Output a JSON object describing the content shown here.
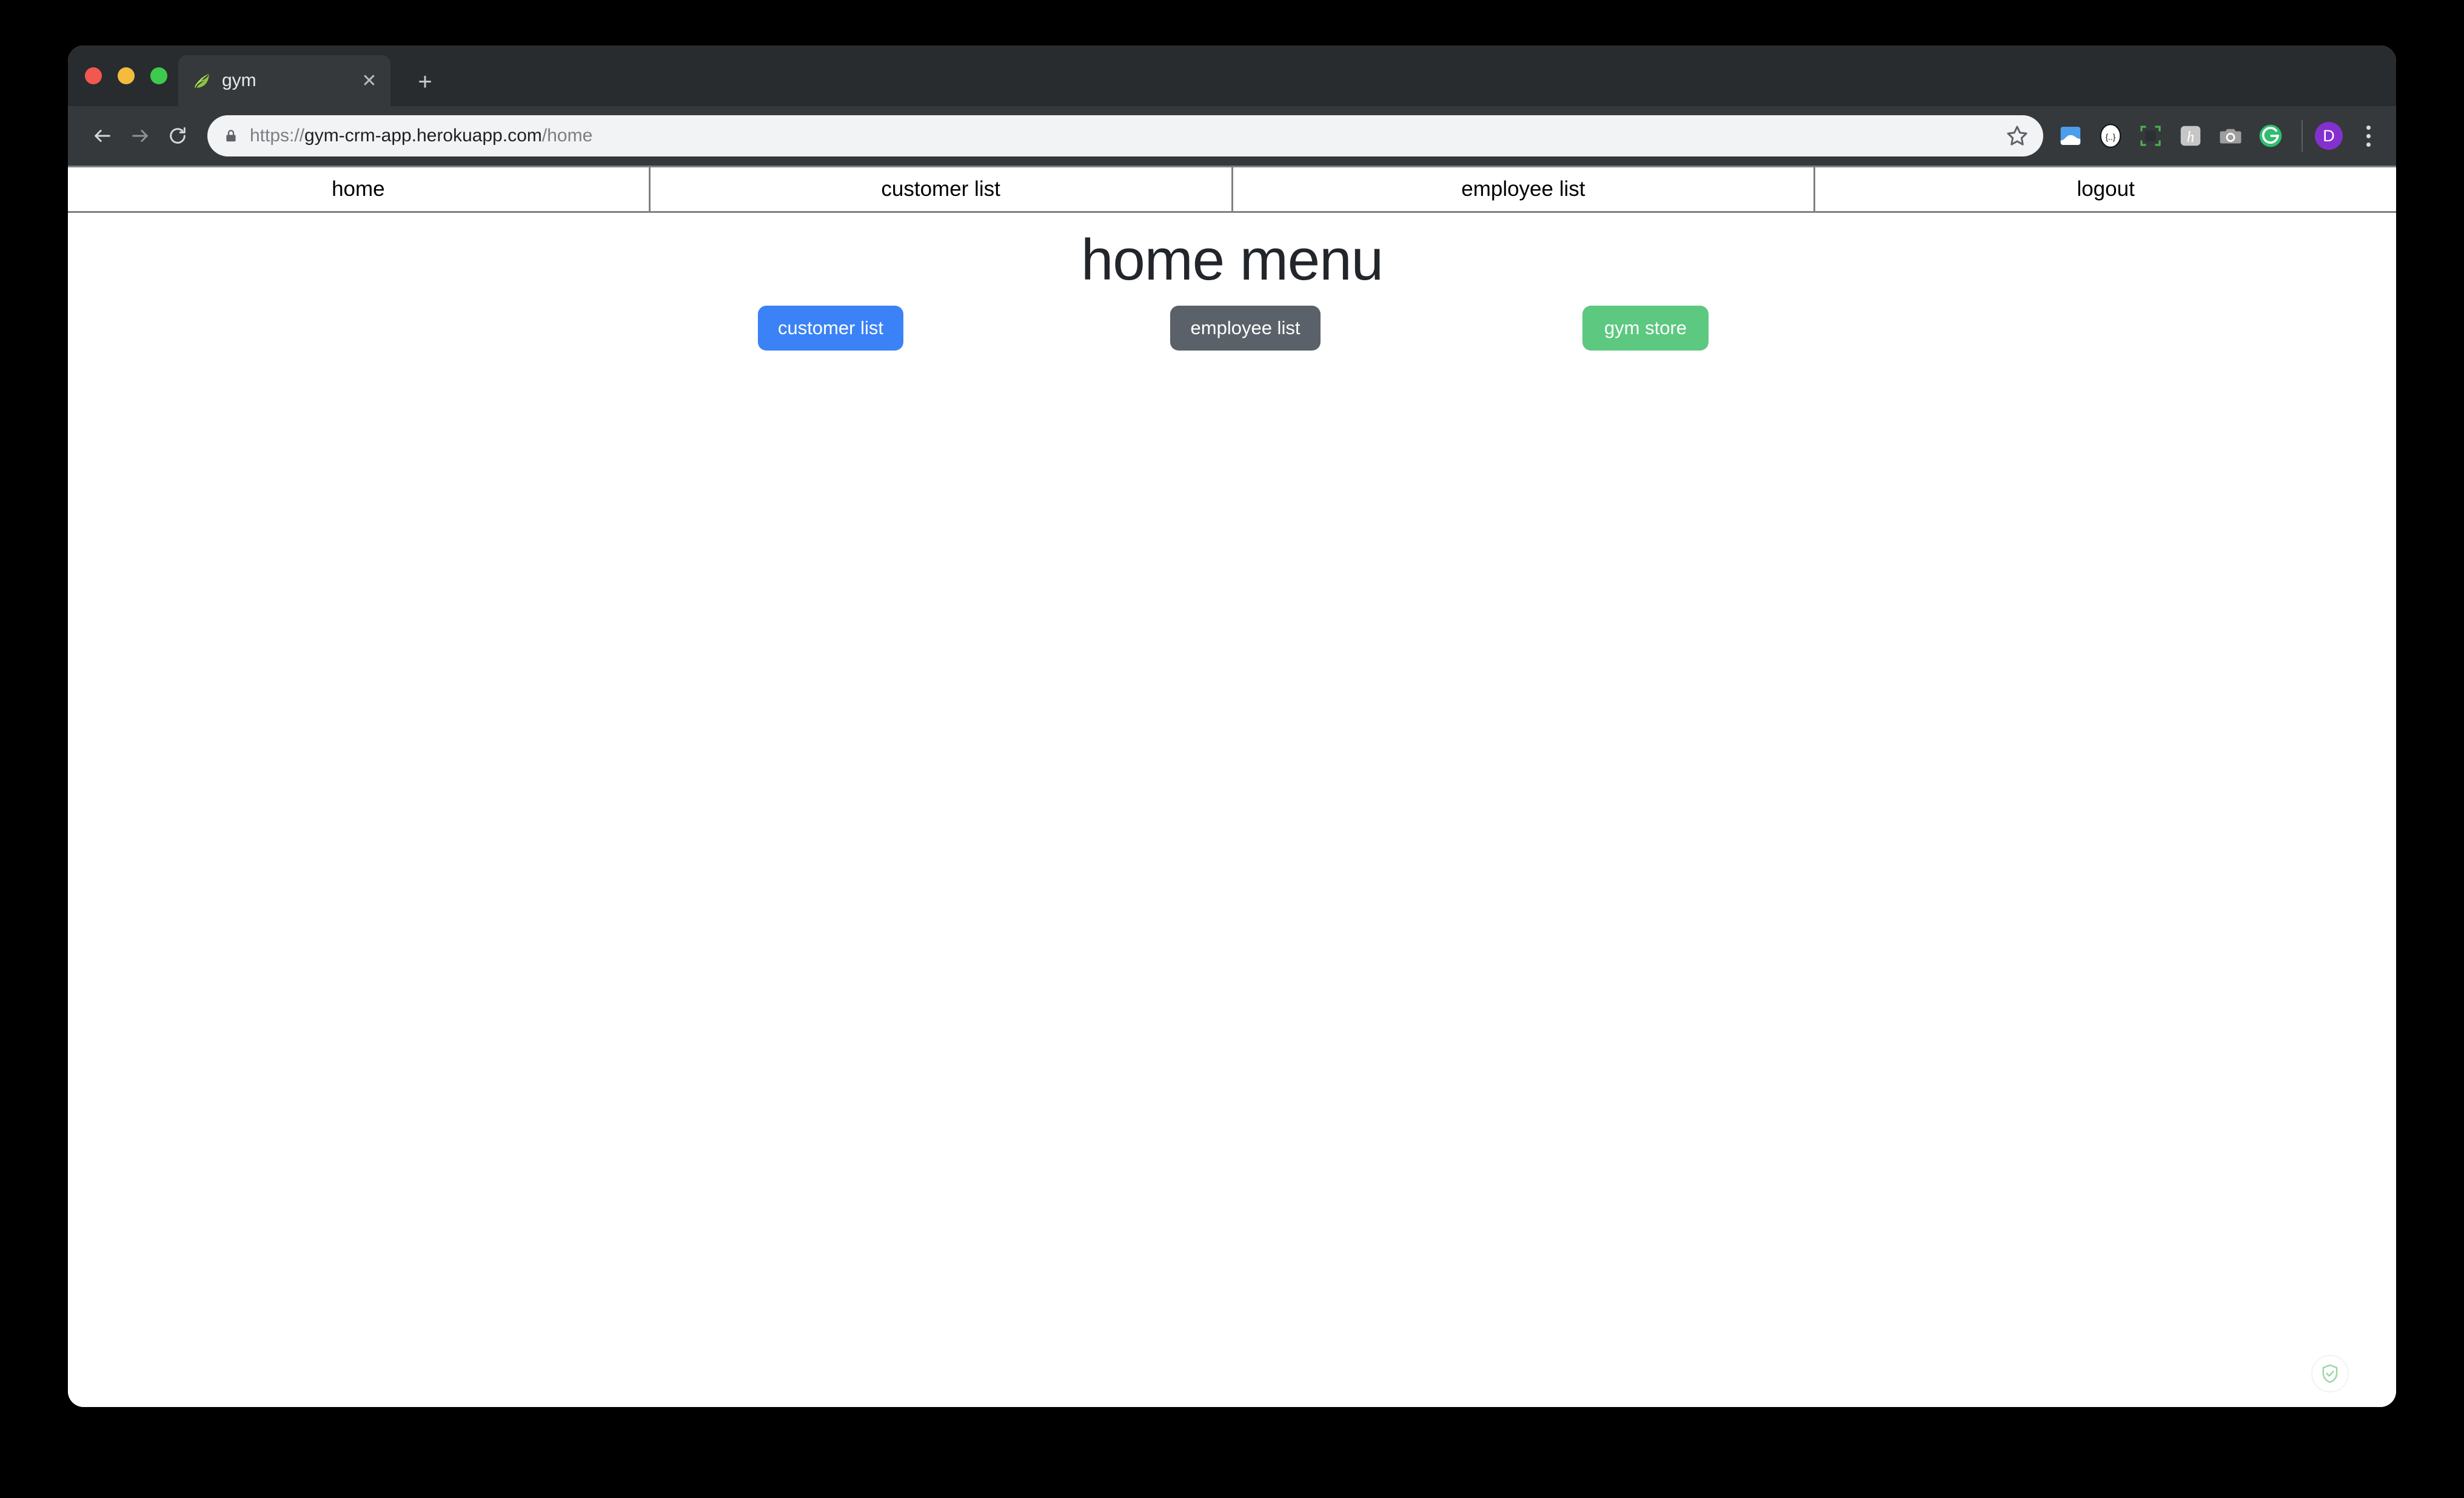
{
  "browser": {
    "traffic_lights": [
      {
        "name": "close",
        "color": "#f2584f"
      },
      {
        "name": "minimize",
        "color": "#f4bc3e"
      },
      {
        "name": "maximize",
        "color": "#3ecb4d"
      }
    ],
    "tab": {
      "title": "gym",
      "favicon": "spring-leaf-icon",
      "close_label": "✕"
    },
    "new_tab_label": "+",
    "nav": {
      "back": "back-arrow-icon",
      "forward": "forward-arrow-icon",
      "reload": "reload-icon"
    },
    "omnibox": {
      "lock": "lock-icon",
      "url_scheme": "https://",
      "url_host": "gym-crm-app.herokuapp.com",
      "url_path": "/home",
      "full_url": "https://gym-crm-app.herokuapp.com/home",
      "bookmark": "star-icon"
    },
    "extensions": [
      {
        "name": "blue-document-extension",
        "label": ""
      },
      {
        "name": "curly-braces-extension",
        "label": "{..}"
      },
      {
        "name": "green-corners-extension",
        "label": ""
      },
      {
        "name": "honey-extension",
        "label": "h"
      },
      {
        "name": "camera-extension",
        "label": ""
      },
      {
        "name": "grammarly-extension",
        "label": "G"
      }
    ],
    "profile": {
      "initial": "D",
      "color": "#8430ce"
    },
    "menu": "three-dot-menu-icon"
  },
  "site": {
    "nav_items": [
      {
        "label": "home"
      },
      {
        "label": "customer list"
      },
      {
        "label": "employee list"
      },
      {
        "label": "logout"
      }
    ],
    "heading": "home menu",
    "buttons": [
      {
        "label": "customer list",
        "color": "#3b82f6"
      },
      {
        "label": "employee list",
        "color": "#5a6169"
      },
      {
        "label": "gym store",
        "color": "#5cc880"
      }
    ],
    "corner_badge": "adguard-shield-icon"
  }
}
